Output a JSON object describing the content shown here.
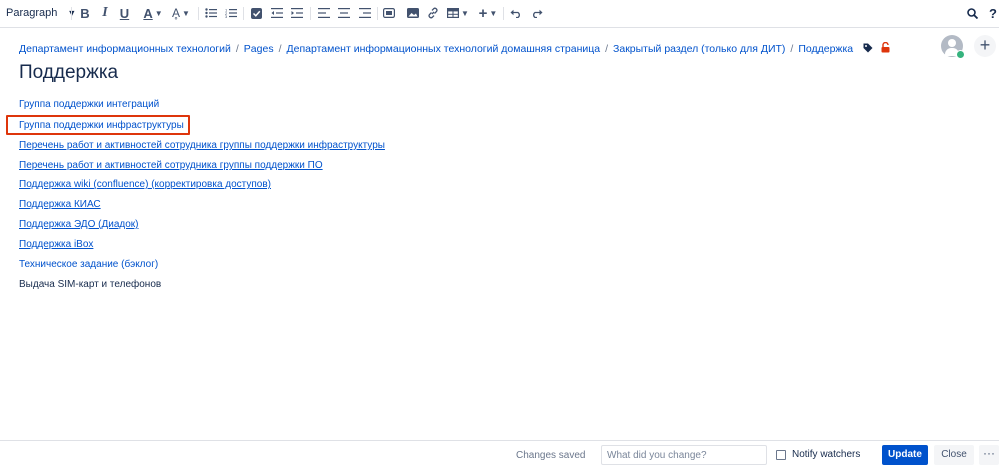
{
  "toolbar": {
    "paragraph_label": "Paragraph",
    "tools": [
      "bold-icon",
      "italic-icon",
      "underline-icon",
      "text-color-icon",
      "text-style-icon",
      "bullet-list-icon",
      "numbered-list-icon",
      "task-icon",
      "outdent-icon",
      "indent-icon",
      "align-left-icon",
      "align-center-icon",
      "align-right-icon",
      "layout-icon",
      "image-icon",
      "link-icon",
      "table-icon",
      "insert-icon",
      "undo-icon",
      "redo-icon",
      "search-icon",
      "help-icon"
    ],
    "help_label": "?"
  },
  "breadcrumb": {
    "items": [
      "Департамент информационных технологий",
      "Pages",
      "Департамент информационных технологий домашняя страница",
      "Закрытый раздел (только для ДИТ)",
      "Поддержка"
    ]
  },
  "page": {
    "title": "Поддержка",
    "links": [
      {
        "text": "Группа поддержки интеграций",
        "style": "link"
      },
      {
        "text": "Группа поддержки инфраструктуры",
        "style": "link",
        "highlighted": true
      },
      {
        "text": "Перечень работ и активностей сотрудника группы поддержки инфраструктуры",
        "style": "underlined"
      },
      {
        "text": "Перечень работ и активностей сотрудника группы поддержки ПО",
        "style": "underlined"
      },
      {
        "text": "Поддержка wiki (confluence) (корректировка доступов)",
        "style": "underlined"
      },
      {
        "text": "Поддержка КИАС",
        "style": "underlined"
      },
      {
        "text": "Поддержка ЭДО (Диадок)",
        "style": "underlined"
      },
      {
        "text": "Поддержка iBox",
        "style": "underlined"
      },
      {
        "text": "Техническое задание (бэклог)",
        "style": "link"
      },
      {
        "text": "Выдача SIM-карт и телефонов",
        "style": "plain"
      }
    ]
  },
  "footer": {
    "status": "Changes saved",
    "change_placeholder": "What did you change?",
    "notify_label": "Notify watchers",
    "update_label": "Update",
    "close_label": "Close",
    "more_label": "···"
  },
  "colors": {
    "accent": "#0052cc",
    "highlight_border": "#de350b",
    "presence": "#36b37e"
  }
}
